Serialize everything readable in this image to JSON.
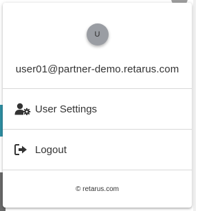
{
  "profile": {
    "avatar_initial": "U",
    "email": "user01@partner-demo.retarus.com"
  },
  "menu": {
    "items": [
      {
        "label": "User Settings",
        "icon": "user-cog-icon"
      },
      {
        "label": "Logout",
        "icon": "sign-out-icon"
      }
    ]
  },
  "footer": {
    "copyright": "© retarus.com"
  },
  "colors": {
    "avatar_bg": "#9a9da3",
    "text": "#333333",
    "divider": "#d8d8d8"
  }
}
